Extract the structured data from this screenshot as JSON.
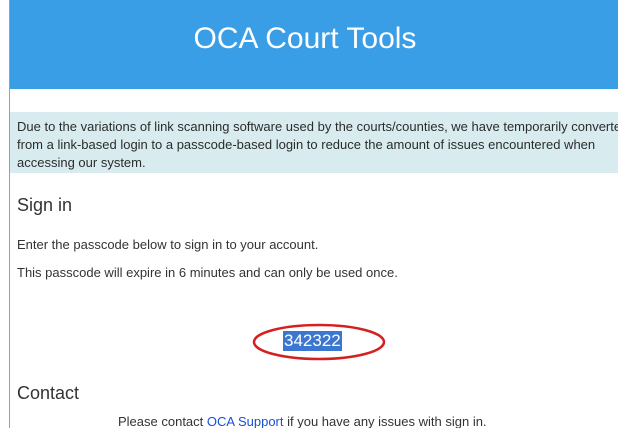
{
  "header": {
    "title": "OCA Court Tools"
  },
  "notice": {
    "text": "Due to the variations of link scanning software used by the courts/counties, we have temporarily converted from a link-based login to a passcode-based login to reduce the amount of issues encountered when accessing our system."
  },
  "sign_in": {
    "heading": "Sign in",
    "instruction": "Enter the passcode below to sign in to your account.",
    "expiry_note": "This passcode will expire in 6 minutes and can only be used once.",
    "passcode": "342322"
  },
  "contact": {
    "heading": "Contact",
    "text_before": "Please contact ",
    "link_label": "OCA Support",
    "text_after": " if you have any issues with sign in."
  },
  "colors": {
    "header_bg": "#3a9ee6",
    "notice_bg": "#d8ecf0",
    "highlight": "#3b76d0",
    "annotation_oval": "#d42020",
    "link": "#1a4fd6"
  }
}
